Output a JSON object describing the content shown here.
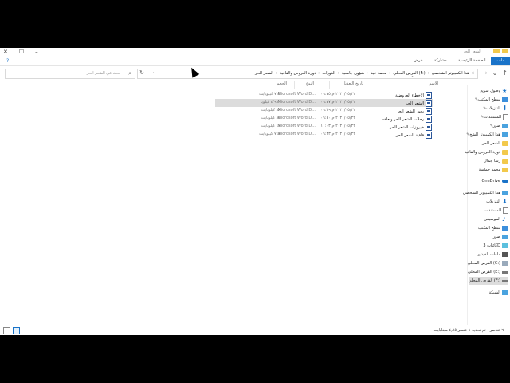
{
  "window": {
    "title": "الشعر الحر",
    "minimize": "–",
    "maximize": "☐",
    "close": "✕"
  },
  "ribbon": {
    "tabs": [
      "ملف",
      "الصفحة الرئيسية",
      "مشاركة",
      "عرض"
    ],
    "help": "?"
  },
  "address": {
    "crumbs": [
      "هذا الكمبيوتر الشخصي",
      "القرص المحلي (F:)",
      "محمد عيد",
      "شؤون جامعية",
      "الدورات",
      "دورة العروض والقافية",
      "الشعر الحر"
    ],
    "root_arrow": "»",
    "refresh": "↻",
    "dropdown": "⌄",
    "back": "←",
    "forward": "→",
    "recent": "⌄",
    "up": "↑"
  },
  "search": {
    "placeholder": "بحث في الشعر الحر",
    "icon": "⌕"
  },
  "columns": {
    "name": "الاسم",
    "date": "تاريخ التعديل",
    "type": "النوع",
    "size": "الحجم",
    "sort_arrow": "^"
  },
  "files": [
    {
      "name": "الأخطاء العروضية",
      "date": "٢٠٢١/٠٥/٢٢ م ٠٩:٤٥",
      "type": "Microsoft Word D...",
      "size": "٧١٥ كيلوبايت"
    },
    {
      "name": "الشعر الحر",
      "date": "٢٠٢١/٠٥/٢٢ م ٠٩:٤٧",
      "type": "Microsoft Word D...",
      "size": "٤٬٩٨٠ كيلوبا"
    },
    {
      "name": "بحور الشعر الحر",
      "date": "٢٠٢١/٠٥/٢٢ م ٠٩:٣٩",
      "type": "Microsoft Word D...",
      "size": "٨٨ كيلوبايت"
    },
    {
      "name": "رحلات الشعر الحر وتعلقه",
      "date": "٢٠٢١/٠٥/٢٢ م ٠٩:٤٠",
      "type": "Microsoft Word D...",
      "size": "٨٥ كيلوبايت"
    },
    {
      "name": "خيروزات الشعر الحر",
      "date": "٢٠٢١/٠٥/٢٢ م ١٠:٠٣",
      "type": "Microsoft Word D...",
      "size": "٤٧ كيلوبايت"
    },
    {
      "name": "قافية الشعر الحر",
      "date": "٢٠٢١/٠٥/٢٢ م ٠٩:٣٣",
      "type": "Microsoft Word D...",
      "size": "٧٤٤ كيلوبايت"
    }
  ],
  "nav": {
    "quick_access": "وصول سريع",
    "quick_items": [
      "سطح المكتب",
      "التنزيلات",
      "المستندات",
      "صور",
      "هذا الكمبيوتر الشخ",
      "الشعر الحر",
      "دورة العروض والقافية",
      "رشا جمال",
      "محمد حماسة"
    ],
    "pin": "✎",
    "onedrive": "OneDrive",
    "this_pc": "هذا الكمبيوتر الشخصي",
    "pc_items": [
      "التنزيلات",
      "المستندات",
      "الموسيقى",
      "سطح المكتب",
      "صور",
      "كائنات 3D",
      "ملفات الفيديو",
      "القرص المحلي (C:)",
      "القرص المحلي (E:)",
      "القرص المحلي (F:)"
    ],
    "network": "الشبكة"
  },
  "status": {
    "count": "٦ عناصر",
    "selection": "تم تحديد ١ عنصر  ٤٫٨٥ ميغابايت"
  },
  "colors": {
    "accent": "#1a73c8",
    "folder": "#f2c94c",
    "word": "#2b579a"
  }
}
